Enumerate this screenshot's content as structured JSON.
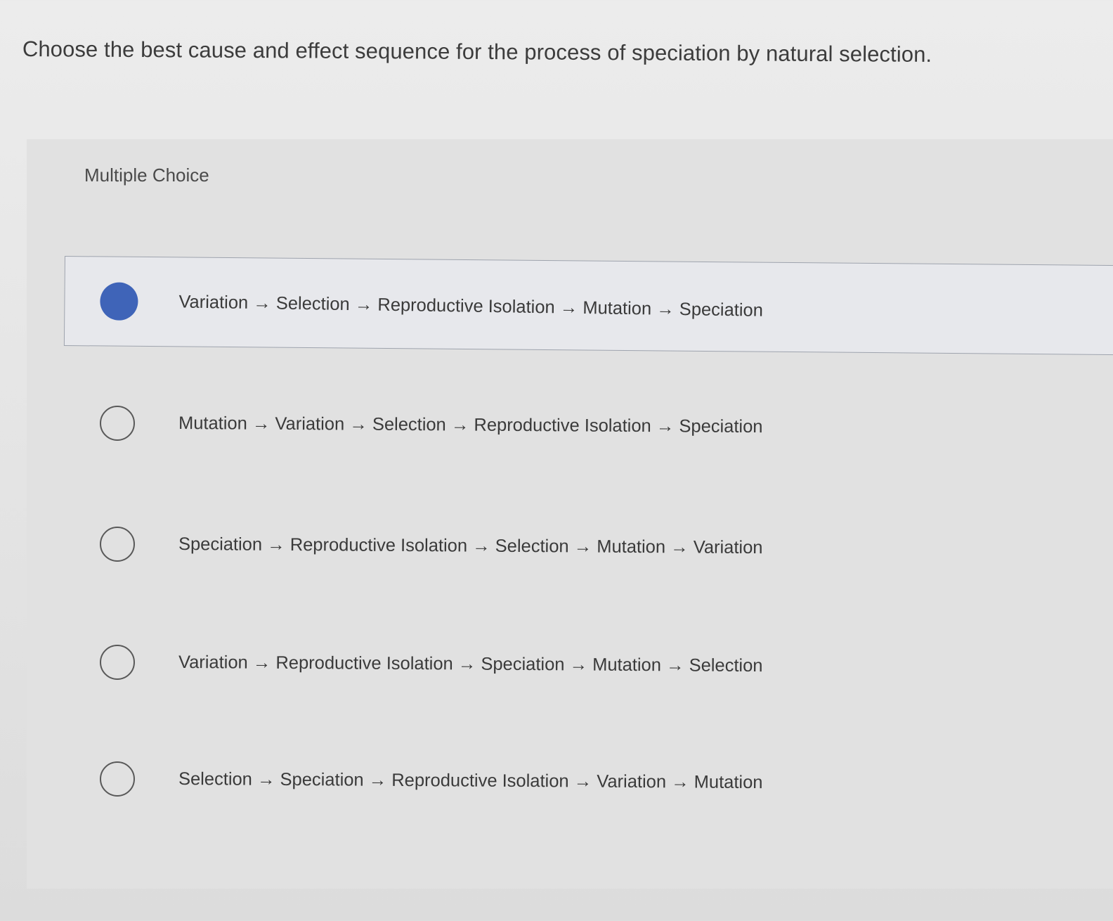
{
  "question": {
    "text": "Choose the best cause and effect sequence for the process of speciation by natural selection."
  },
  "quiz": {
    "type_label": "Multiple Choice",
    "selected_index": 0,
    "options": [
      {
        "label": "Variation → Selection → Reproductive Isolation → Mutation → Speciation",
        "selected": true
      },
      {
        "label": "Mutation → Variation → Selection → Reproductive Isolation → Speciation",
        "selected": false
      },
      {
        "label": "Speciation → Reproductive Isolation → Selection → Mutation → Variation",
        "selected": false
      },
      {
        "label": "Variation → Reproductive Isolation → Speciation → Mutation → Selection",
        "selected": false
      },
      {
        "label": "Selection → Speciation → Reproductive Isolation → Variation → Mutation",
        "selected": false
      }
    ]
  },
  "colors": {
    "selected_radio": "#3f64b8",
    "panel_background": "#e1e1e1"
  }
}
